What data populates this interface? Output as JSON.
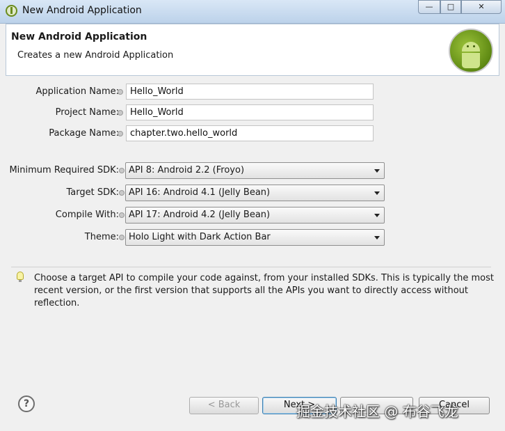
{
  "window": {
    "title": "New Android Application",
    "controls": {
      "minimize": "—",
      "maximize": "□",
      "close": "✕"
    }
  },
  "banner": {
    "title": "New Android Application",
    "description": "Creates a new Android Application"
  },
  "form": {
    "application_name": {
      "label": "Application Name:",
      "value": "Hello_World"
    },
    "project_name": {
      "label": "Project Name:",
      "value": "Hello_World"
    },
    "package_name": {
      "label": "Package Name:",
      "value": "chapter.two.hello_world"
    },
    "min_sdk": {
      "label": "Minimum Required SDK:",
      "value": "API 8: Android 2.2 (Froyo)"
    },
    "target_sdk": {
      "label": "Target SDK:",
      "value": "API 16: Android 4.1 (Jelly Bean)"
    },
    "compile_with": {
      "label": "Compile With:",
      "value": "API 17: Android 4.2 (Jelly Bean)"
    },
    "theme": {
      "label": "Theme:",
      "value": "Holo Light with Dark Action Bar"
    }
  },
  "hint": "Choose a target API to compile your code against, from your installed SDKs. This is typically the most recent version, or the first version that supports all the APIs you want to directly access without reflection.",
  "buttons": {
    "help": "?",
    "back": "< Back",
    "next": "Next >",
    "finish": "",
    "cancel": "Cancel"
  },
  "watermark": "掘金技术社区 @ 布谷飞龙",
  "icons": [
    "android-app-icon",
    "android-logo-icon",
    "info-decoration-icon",
    "lightbulb-icon",
    "help-icon",
    "dropdown-arrow-icon"
  ]
}
